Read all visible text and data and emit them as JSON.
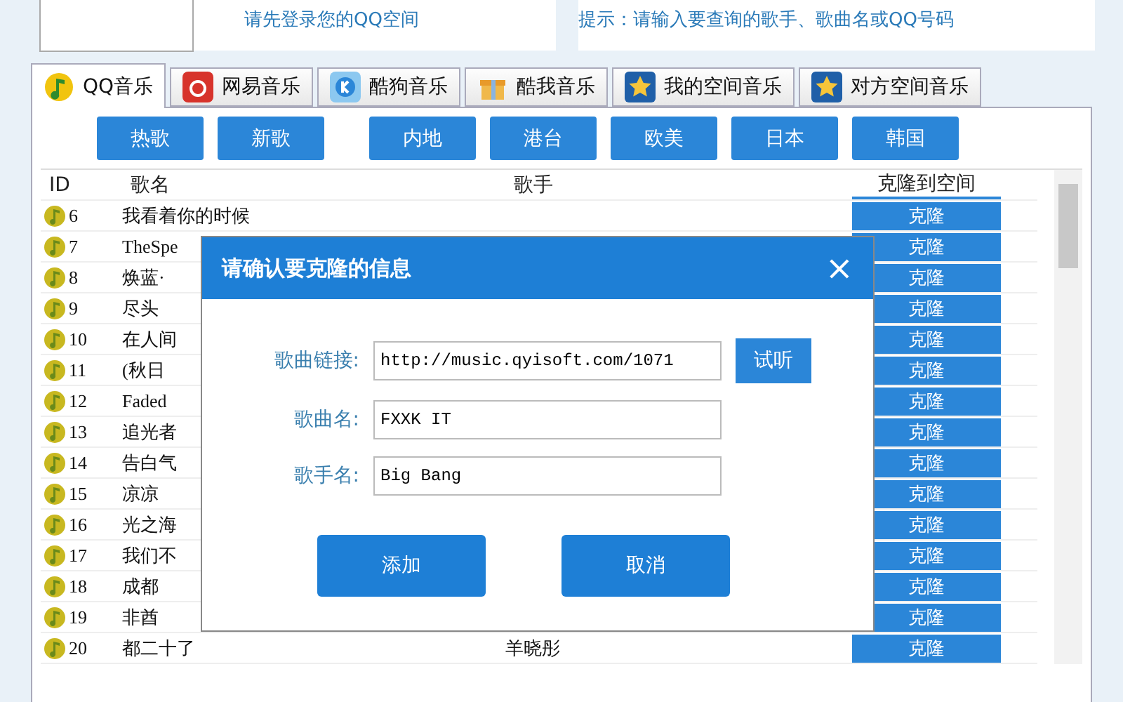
{
  "header": {
    "login_hint": "请先登录您的QQ空间",
    "search_hint": "提示：请输入要查询的歌手、歌曲名或QQ号码"
  },
  "tabs": [
    {
      "label": "QQ音乐",
      "selected": true
    },
    {
      "label": "网易音乐",
      "selected": false
    },
    {
      "label": "酷狗音乐",
      "selected": false
    },
    {
      "label": "酷我音乐",
      "selected": false
    },
    {
      "label": "我的空间音乐",
      "selected": false
    },
    {
      "label": "对方空间音乐",
      "selected": false
    }
  ],
  "category_groups": [
    [
      "热歌",
      "新歌"
    ],
    [
      "内地",
      "港台",
      "欧美",
      "日本",
      "韩国"
    ]
  ],
  "table": {
    "columns": [
      "ID",
      "歌名",
      "歌手",
      "克隆到空间"
    ],
    "rows": [
      {
        "id": "6",
        "title": "我看着你的时候",
        "action": "克隆"
      },
      {
        "id": "7",
        "title": "TheSpe",
        "action": "克隆"
      },
      {
        "id": "8",
        "title": "焕蓝·",
        "action": "克隆"
      },
      {
        "id": "9",
        "title": "尽头",
        "action": "克隆"
      },
      {
        "id": "10",
        "title": "在人间",
        "action": "克隆"
      },
      {
        "id": "11",
        "title": "(秋日",
        "action": "克隆"
      },
      {
        "id": "12",
        "title": "Faded",
        "action": "克隆"
      },
      {
        "id": "13",
        "title": "追光者",
        "action": "克隆"
      },
      {
        "id": "14",
        "title": "告白气",
        "action": "克隆"
      },
      {
        "id": "15",
        "title": "凉凉",
        "action": "克隆"
      },
      {
        "id": "16",
        "title": "光之海",
        "action": "克隆"
      },
      {
        "id": "17",
        "title": "我们不",
        "action": "克隆"
      },
      {
        "id": "18",
        "title": "成都",
        "action": "克隆"
      },
      {
        "id": "19",
        "title": "非酋",
        "action": "克隆"
      },
      {
        "id": "20",
        "title": "都二十了",
        "artist": "羊晓彤",
        "action": "克隆"
      }
    ]
  },
  "dialog": {
    "title": "请确认要克隆的信息",
    "close": "×",
    "fields": [
      {
        "label": "歌曲链接:",
        "value": "http://music.qyisoft.com/1071"
      },
      {
        "label": "歌曲名:",
        "value": "FXXK IT"
      },
      {
        "label": "歌手名:",
        "value": "Big Bang"
      }
    ],
    "listen_button": "试听",
    "buttons": [
      "添加",
      "取消"
    ]
  }
}
